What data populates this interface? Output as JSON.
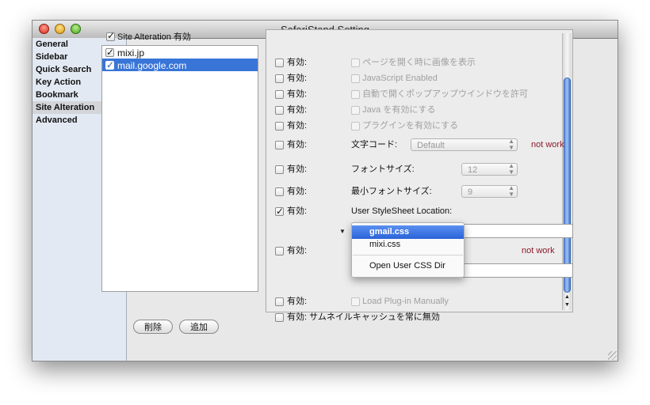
{
  "window": {
    "title": "SafariStand Setting"
  },
  "sidebar": {
    "items": [
      {
        "label": "General"
      },
      {
        "label": "Sidebar"
      },
      {
        "label": "Quick Search"
      },
      {
        "label": "Key Action"
      },
      {
        "label": "Bookmark"
      },
      {
        "label": "Site Alteration",
        "selected": true
      },
      {
        "label": "Advanced"
      }
    ]
  },
  "site_alteration": {
    "label": "Site Alteration 有効",
    "checked": true
  },
  "sites": [
    {
      "name": "mixi.jp",
      "checked": true
    },
    {
      "name": "mail.google.com",
      "checked": true,
      "selected": true
    }
  ],
  "buttons": {
    "delete": "削除",
    "add": "追加"
  },
  "settings": {
    "enabled_label": "有効:",
    "images": "ページを開く時に画像を表示",
    "javascript": "JavaScript Enabled",
    "popups": "自動で開くポップアップウインドウを許可",
    "java": "Java を有効にする",
    "plugins": "プラグインを有効にする",
    "encoding_label": "文字コード:",
    "encoding_value": "Default",
    "font_size_label": "フォントサイズ:",
    "font_size_value": "12",
    "min_font_size_label": "最小フォントサイズ:",
    "min_font_size_value": "9",
    "stylesheet_label": "User StyleSheet Location:",
    "load_plugin": "Load Plug-in Manually",
    "thumbnail_label": "有効: サムネイルキャッシュを常に無効",
    "not_work": "not work"
  },
  "stylesheet_menu": {
    "items": [
      "gmail.css",
      "mixi.css"
    ],
    "highlighted": "gmail.css",
    "action": "Open User CSS Dir"
  },
  "colors": {
    "selection": "#3875d7",
    "not_work": "#8b1a2b",
    "scroll_thumb": "#5f8ed9"
  }
}
